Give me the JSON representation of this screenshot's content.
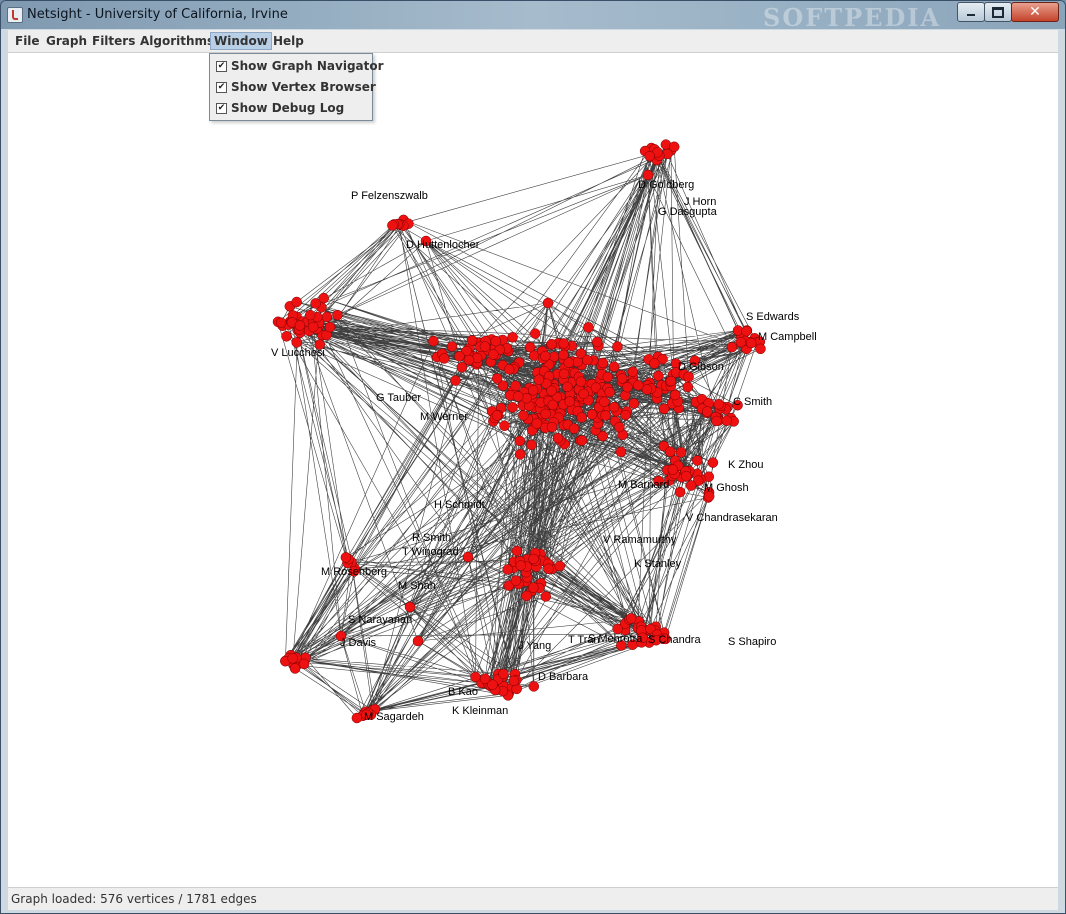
{
  "window": {
    "title": "Netsight - University of California, Irvine",
    "watermark": "SOFTPEDIA"
  },
  "menubar": {
    "items": [
      "File",
      "Graph",
      "Filters",
      "Algorithms",
      "Window",
      "Help"
    ],
    "active": "Window"
  },
  "window_menu": {
    "items": [
      {
        "label": "Show Graph Navigator",
        "checked": true
      },
      {
        "label": "Show Vertex Browser",
        "checked": true
      },
      {
        "label": "Show Debug Log",
        "checked": true
      }
    ]
  },
  "graph": {
    "node_color": "#ee1111",
    "edge_color": "#000000",
    "labels": [
      "D Huttenlocher",
      "P Felzenszwalb",
      "M Shah",
      "J Davis",
      "R Smith",
      "T Winograd",
      "M Rosenberg",
      "S Narayanan",
      "D Barbara",
      "B Kao",
      "M Sagardeh",
      "K Kleinman",
      "J Yang",
      "S Mehrotra",
      "S Chandra",
      "S Shapiro",
      "V Lucchesi",
      "G Tauber",
      "M Werner",
      "H Schmidt",
      "D Goldberg",
      "G Dasgupta",
      "J Horn",
      "M Campbell",
      "S Edwards",
      "D Gibson",
      "C Smith",
      "M Barnard",
      "K Zhou",
      "M Ghosh",
      "V Ramamurthy",
      "V Chandrasekaran",
      "K Stanley",
      "T Tran"
    ]
  },
  "status": {
    "text": "Graph loaded: 576 vertices / 1781 edges"
  }
}
